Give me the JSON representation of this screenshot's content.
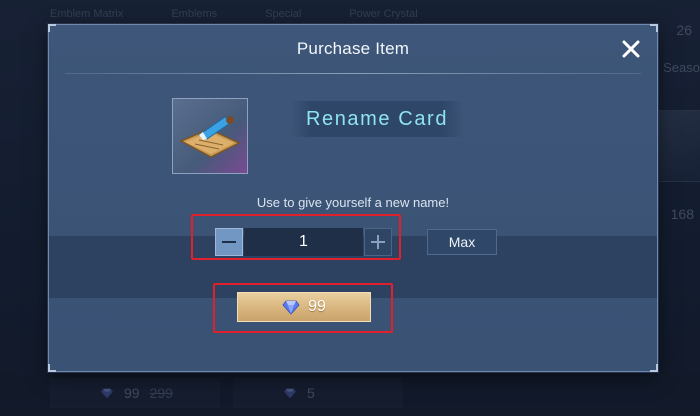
{
  "background": {
    "tabs": [
      "Emblem Matrix",
      "Emblems",
      "Special",
      "Power Crystal"
    ],
    "right_count": "26",
    "right_label": "Seaso",
    "right_price": "168",
    "bottom_items": [
      {
        "price": "99",
        "old_price": "299"
      },
      {
        "price": "5"
      }
    ]
  },
  "dialog": {
    "title": "Purchase Item",
    "item_name": "Rename Card",
    "description": "Use to give yourself a new name!",
    "quantity": "1",
    "max_label": "Max",
    "price": "99"
  },
  "colors": {
    "accent_cyan": "#8fe3f2",
    "buy_gold": "#d8b57e",
    "highlight_red": "#e0202a"
  },
  "icons": [
    "close-icon",
    "minus-icon",
    "plus-icon",
    "diamond-icon",
    "rename-card-icon"
  ]
}
